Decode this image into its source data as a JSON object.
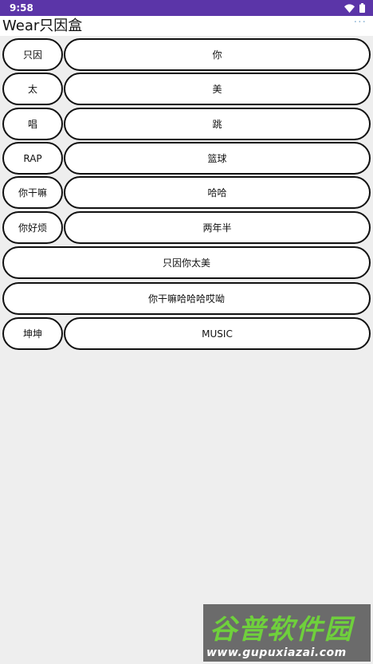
{
  "status_bar": {
    "time": "9:58",
    "icons": [
      "wifi-icon",
      "battery-icon"
    ],
    "color": "#5b35a8"
  },
  "app_bar": {
    "title": "Wear只因盒",
    "overflow_icon": "more-dots-icon"
  },
  "rows": [
    {
      "left": "只因",
      "right": "你"
    },
    {
      "left": "太",
      "right": "美"
    },
    {
      "left": "唱",
      "right": "跳"
    },
    {
      "left": "RAP",
      "right": "篮球"
    },
    {
      "left": "你干嘛",
      "right": "哈哈"
    },
    {
      "left": "你好烦",
      "right": "两年半"
    }
  ],
  "full_buttons": [
    {
      "label": "只因你太美"
    },
    {
      "label": "你干嘛哈哈哈哎呦"
    }
  ],
  "last_row": {
    "left": "坤坤",
    "right": "MUSIC"
  },
  "watermark": {
    "main": "谷普软件园",
    "sub": "www.gupuxiazai.com"
  }
}
